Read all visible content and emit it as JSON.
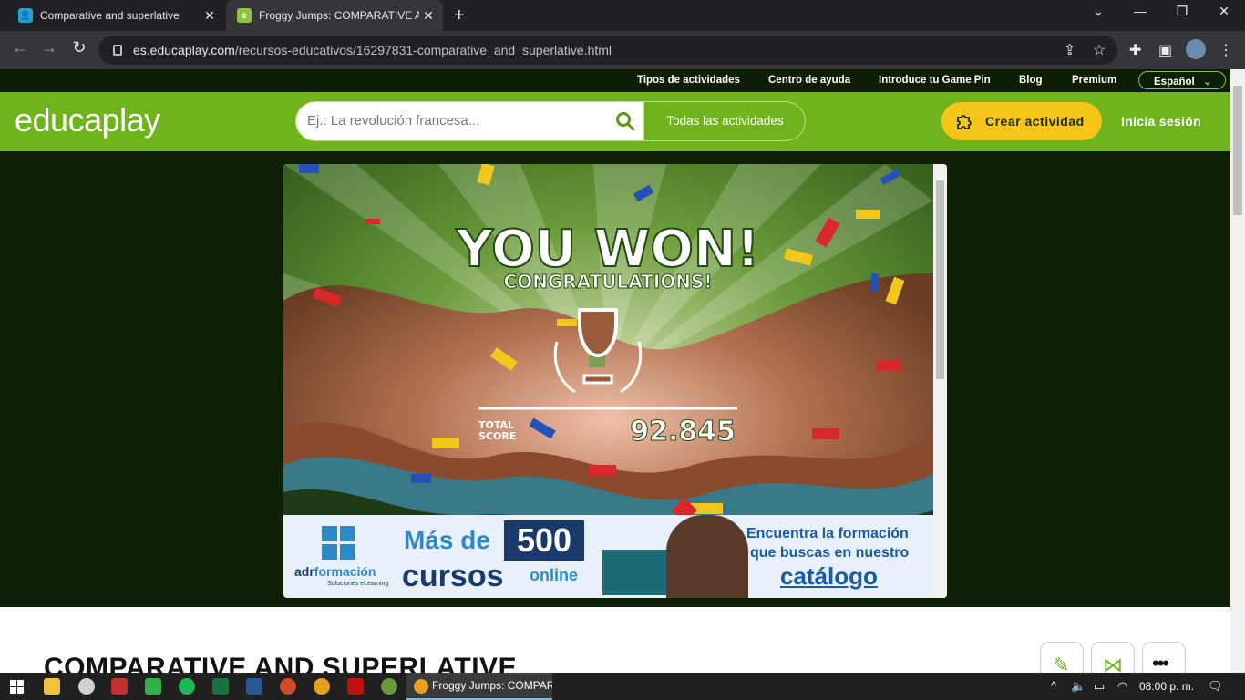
{
  "browser": {
    "tabs": [
      {
        "title": "Comparative and superlative",
        "active": false
      },
      {
        "title": "Froggy Jumps: COMPARATIVE AND SUPERLATIVE",
        "active": true
      }
    ],
    "url_host": "es.educaplay.com",
    "url_path": "/recursos-educativos/16297831-comparative_and_superlative.html"
  },
  "site": {
    "topnav": [
      "Tipos de actividades",
      "Centro de ayuda",
      "Introduce tu Game Pin",
      "Blog",
      "Premium"
    ],
    "language": "Español",
    "logo": "educaplay",
    "search_placeholder": "Ej.: La revolución francesa...",
    "search_scope": "Todas las actividades",
    "create_label": "Crear actividad",
    "login_label": "Inicia sesión"
  },
  "game": {
    "headline": "YOU WON!",
    "subheadline": "CONGRATULATIONS!",
    "score_label_1": "TOTAL",
    "score_label_2": "SCORE",
    "score_value": "92.845"
  },
  "ad": {
    "brand_1": "adr",
    "brand_2": "formación",
    "brand_tag": "Soluciones eLearning",
    "mas_de": "Más de",
    "count": "500",
    "cursos": "cursos",
    "online": "online",
    "line1": "Encuentra la formación",
    "line2": "que buscas en nuestro",
    "line3": "catálogo"
  },
  "page": {
    "title": "COMPARATIVE AND SUPERLATIVE"
  },
  "taskbar": {
    "running_app": "Froggy Jumps: COMPARATIVE AND SUPERLATIVE",
    "clock": "08:00 p. m."
  },
  "colors": {
    "brand_green": "#6fb31d",
    "dark_bg": "#0f2006",
    "create_yellow": "#f5c518"
  }
}
